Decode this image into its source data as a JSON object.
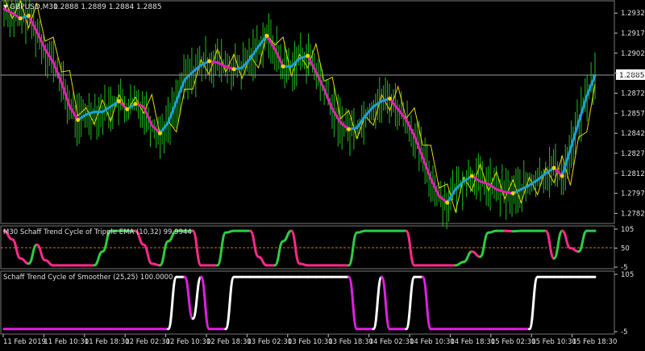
{
  "main": {
    "symbol_label": "GBPUSD,M30",
    "ohlc_label": "1.2888 1.2889 1.2884 1.2885",
    "current_price": "1.2885",
    "price_ticks": [
      "1.2932",
      "1.2917",
      "1.2902",
      "1.2887",
      "1.2872",
      "1.2857",
      "1.2842",
      "1.2827",
      "1.2812",
      "1.2797",
      "1.2782"
    ],
    "colors": {
      "bars": "#1fbf1f",
      "band": "#e6d800",
      "trend_up": "#1aa0d8",
      "trend_down": "#e020b0",
      "dot": "#ffd000",
      "bg": "#000000",
      "axis": "#c0c0c0"
    }
  },
  "stc_triple_ema": {
    "title": "M30 Schaff Trend Cycle of Tripple EMA (10,32) 99.9944",
    "ticks": [
      "105",
      "50",
      "-5"
    ],
    "colors": {
      "up": "#2ecc40",
      "down": "#ff2a8a",
      "level": "#c87a00"
    }
  },
  "stc_smoother": {
    "title": "Schaff Trend Cycle of Smoother (25,25) 100.0000",
    "ticks": [
      "105",
      "-5"
    ],
    "colors": {
      "up": "#ffffff",
      "down": "#e020e0"
    }
  },
  "time_axis": {
    "labels": [
      "11 Feb 2019",
      "11 Feb 10:30",
      "11 Feb 18:30",
      "12 Feb 02:30",
      "12 Feb 10:30",
      "12 Feb 18:30",
      "13 Feb 02:30",
      "13 Feb 10:30",
      "13 Feb 18:30",
      "14 Feb 02:30",
      "14 Feb 10:30",
      "14 Feb 18:30",
      "15 Feb 02:30",
      "15 Feb 10:30",
      "15 Feb 18:30"
    ]
  },
  "chart_data": [
    {
      "type": "line",
      "title": "GBPUSD,M30",
      "ylim": [
        1.2775,
        1.294
      ],
      "series": [
        {
          "name": "Trend Line",
          "values": [
            1.2935,
            1.2932,
            1.2928,
            1.293,
            1.2918,
            1.2905,
            1.2895,
            1.288,
            1.2862,
            1.2852,
            1.2856,
            1.2858,
            1.2858,
            1.2862,
            1.2866,
            1.286,
            1.2864,
            1.2862,
            1.2848,
            1.2842,
            1.285,
            1.2866,
            1.2882,
            1.2888,
            1.2893,
            1.2896,
            1.2895,
            1.2892,
            1.289,
            1.2891,
            1.2898,
            1.2907,
            1.2915,
            1.2905,
            1.2892,
            1.2892,
            1.2898,
            1.29,
            1.2888,
            1.2875,
            1.286,
            1.285,
            1.2845,
            1.2846,
            1.2855,
            1.2862,
            1.2866,
            1.2868,
            1.286,
            1.2852,
            1.284,
            1.2824,
            1.2808,
            1.2795,
            1.279,
            1.28,
            1.2806,
            1.281,
            1.2806,
            1.2804,
            1.28,
            1.2798,
            1.2797,
            1.28,
            1.2803,
            1.2807,
            1.2812,
            1.2816,
            1.281,
            1.283,
            1.285,
            1.287,
            1.2885
          ]
        }
      ]
    },
    {
      "type": "line",
      "title": "M30 Schaff Trend Cycle of Tripple EMA (10,32) 99.9944",
      "ylim": [
        -5,
        105
      ],
      "series": [
        {
          "name": "STC",
          "values": [
            100,
            75,
            20,
            5,
            60,
            15,
            0,
            0,
            0,
            0,
            0,
            0,
            40,
            100,
            100,
            100,
            100,
            60,
            5,
            0,
            70,
            100,
            100,
            100,
            0,
            0,
            0,
            95,
            100,
            100,
            100,
            25,
            0,
            0,
            70,
            100,
            5,
            0,
            0,
            0,
            0,
            0,
            0,
            95,
            100,
            100,
            100,
            100,
            100,
            100,
            0,
            0,
            0,
            0,
            0,
            0,
            10,
            40,
            25,
            95,
            100,
            100,
            99,
            100,
            100,
            100,
            100,
            20,
            100,
            50,
            40,
            100,
            100
          ]
        }
      ]
    },
    {
      "type": "line",
      "title": "Schaff Trend Cycle of Smoother (25,25) 100.0000",
      "ylim": [
        -5,
        105
      ],
      "series": [
        {
          "name": "STC",
          "values": [
            0,
            0,
            0,
            0,
            0,
            0,
            0,
            0,
            0,
            0,
            0,
            0,
            0,
            0,
            0,
            0,
            0,
            0,
            0,
            0,
            0,
            100,
            100,
            20,
            100,
            0,
            0,
            0,
            100,
            100,
            100,
            100,
            100,
            100,
            100,
            100,
            100,
            100,
            100,
            100,
            100,
            100,
            100,
            0,
            0,
            0,
            100,
            0,
            0,
            0,
            100,
            100,
            0,
            0,
            0,
            0,
            0,
            0,
            0,
            0,
            0,
            0,
            0,
            0,
            0,
            100,
            100,
            100,
            100,
            100,
            100,
            100,
            100
          ]
        }
      ]
    }
  ]
}
